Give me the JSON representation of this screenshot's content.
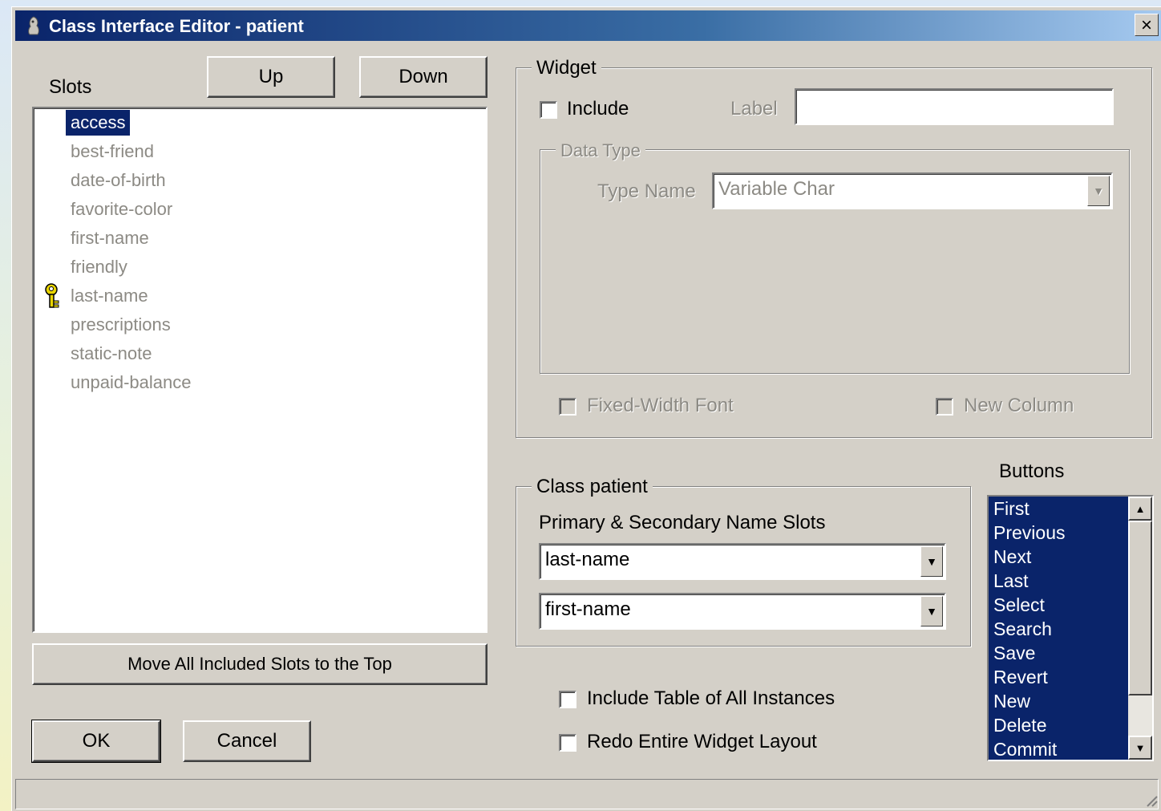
{
  "window": {
    "title": "Class Interface Editor - patient",
    "close_label": "×"
  },
  "slots": {
    "label": "Slots",
    "up_label": "Up",
    "down_label": "Down",
    "items": [
      "access",
      "best-friend",
      "date-of-birth",
      "favorite-color",
      "first-name",
      "friendly",
      "last-name",
      "prescriptions",
      "static-note",
      "unpaid-balance"
    ],
    "selected": "access",
    "key_item": "last-name",
    "move_all_label": "Move All Included Slots to the Top"
  },
  "dialog": {
    "ok_label": "OK",
    "cancel_label": "Cancel"
  },
  "widget": {
    "group_title": "Widget",
    "include_label": "Include",
    "include_checked": false,
    "label_caption": "Label",
    "label_value": "",
    "data_type_title": "Data Type",
    "type_name_caption": "Type Name",
    "type_name_value": "Variable Char",
    "fixed_width_label": "Fixed-Width Font",
    "new_column_label": "New Column"
  },
  "class_group": {
    "title": "Class patient",
    "name_slots_label": "Primary & Secondary Name Slots",
    "primary_value": "last-name",
    "secondary_value": "first-name"
  },
  "options": {
    "include_table_label": "Include Table of All Instances",
    "redo_layout_label": "Redo Entire Widget Layout"
  },
  "buttons": {
    "label": "Buttons",
    "items": [
      "First",
      "Previous",
      "Next",
      "Last",
      "Select",
      "Search",
      "Save",
      "Revert",
      "New",
      "Delete",
      "Commit"
    ]
  }
}
